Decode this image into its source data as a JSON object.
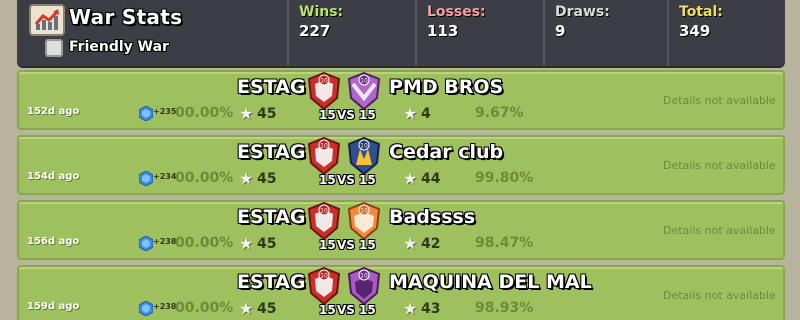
{
  "header": {
    "title": "War Stats",
    "friendly_label": "Friendly War",
    "friendly_checked": false,
    "stats": [
      {
        "label": "Wins:",
        "value": "227",
        "color": "#b9e36a"
      },
      {
        "label": "Losses:",
        "value": "113",
        "color": "#f4a0a0"
      },
      {
        "label": "Draws:",
        "value": "9",
        "color": "#dcdcdc"
      },
      {
        "label": "Total:",
        "value": "349",
        "color": "#f3df5b"
      }
    ]
  },
  "wars": [
    {
      "ago": "152d ago",
      "exp": "+235",
      "our_pct": "00.00%",
      "our_name": "ESTAG",
      "our_stars": "45",
      "our_size": "15",
      "vs": "VS",
      "opp_size": "15",
      "opp_name": "PMD BROS",
      "opp_stars": "4",
      "opp_pct": "9.67%",
      "details": "Details not available",
      "opp_badge_color": "#b167c9"
    },
    {
      "ago": "154d ago",
      "exp": "+234",
      "our_pct": "00.00%",
      "our_name": "ESTAG",
      "our_stars": "45",
      "our_size": "15",
      "vs": "VS",
      "opp_size": "15",
      "opp_name": "Cedar club",
      "opp_stars": "44",
      "opp_pct": "99.80%",
      "details": "Details not available",
      "opp_badge_color": "#2f4e8c"
    },
    {
      "ago": "156d ago",
      "exp": "+238",
      "our_pct": "00.00%",
      "our_name": "ESTAG",
      "our_stars": "45",
      "our_size": "15",
      "vs": "VS",
      "opp_size": "15",
      "opp_name": "Badssss",
      "opp_stars": "42",
      "opp_pct": "98.47%",
      "details": "Details not available",
      "opp_badge_color": "#f28a3c"
    },
    {
      "ago": "159d ago",
      "exp": "+238",
      "our_pct": "00.00%",
      "our_name": "ESTAG",
      "our_stars": "45",
      "our_size": "15",
      "vs": "VS",
      "opp_size": "15",
      "opp_name": "MAQUINA DEL MAL",
      "opp_stars": "43",
      "opp_pct": "98.93%",
      "details": "Details not available",
      "opp_badge_color": "#a85bc4"
    }
  ]
}
